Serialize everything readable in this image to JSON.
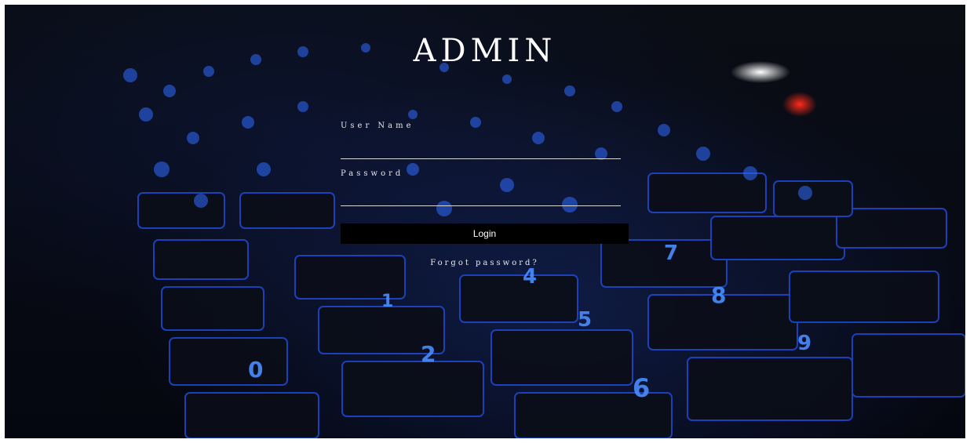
{
  "page": {
    "title": "ADMIN"
  },
  "form": {
    "username_label": "User Name",
    "username_value": "",
    "password_label": "Password",
    "password_value": "",
    "login_label": "Login",
    "forgot_label": "Forgot password?"
  },
  "colors": {
    "text": "#ffffff",
    "button_bg": "#000000",
    "key_glow": "#2f6bff"
  },
  "background": {
    "description_icon": "backlit-keyboard-image"
  }
}
